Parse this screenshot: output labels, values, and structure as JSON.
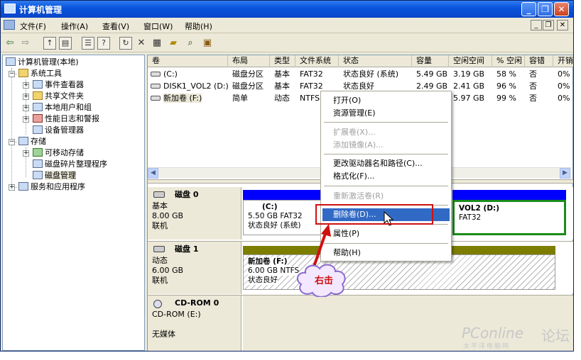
{
  "window": {
    "title": "计算机管理"
  },
  "menu": {
    "items": [
      "文件(F)",
      "操作(A)",
      "查看(V)",
      "窗口(W)",
      "帮助(H)"
    ]
  },
  "toolbar": {
    "icons": [
      "back-icon",
      "forward-icon",
      "up-folder-icon",
      "show-tree-icon",
      "properties-icon",
      "help-icon",
      "refresh-icon",
      "delete-icon",
      "properties2-icon",
      "open-icon",
      "search-icon",
      "help-book-icon"
    ]
  },
  "tree": {
    "root": "计算机管理(本地)",
    "system_tools": "系统工具",
    "event_viewer": "事件查看器",
    "shared_folders": "共享文件夹",
    "local_users": "本地用户和组",
    "perf_logs": "性能日志和警报",
    "device_manager": "设备管理器",
    "storage": "存储",
    "removable": "可移动存储",
    "defrag": "磁盘碎片整理程序",
    "disk_mgmt": "磁盘管理",
    "services": "服务和应用程序"
  },
  "volumes": {
    "columns": [
      "卷",
      "布局",
      "类型",
      "文件系统",
      "状态",
      "容量",
      "空闲空间",
      "% 空闲",
      "容错",
      "开销"
    ],
    "rows": [
      [
        "(C:)",
        "磁盘分区",
        "基本",
        "FAT32",
        "状态良好 (系统)",
        "5.49 GB",
        "3.19 GB",
        "58 %",
        "否",
        "0%"
      ],
      [
        "DISK1_VOL2 (D:)",
        "磁盘分区",
        "基本",
        "FAT32",
        "状态良好",
        "2.49 GB",
        "2.41 GB",
        "96 %",
        "否",
        "0%"
      ],
      [
        "新加卷 (F:)",
        "简单",
        "动态",
        "NTFS",
        "",
        "",
        "5.97 GB",
        "99 %",
        "否",
        "0%"
      ]
    ]
  },
  "disks": {
    "disk0": {
      "name": "磁盘 0",
      "type": "基本",
      "size": "8.00 GB",
      "status": "联机",
      "part1_name": "(C:)",
      "part1_size": "5.50 GB FAT32",
      "part1_status": "状态良好 (系统)",
      "part2_name": "VOL2  (D:)",
      "part2_fs": "FAT32"
    },
    "disk1": {
      "name": "磁盘 1",
      "type": "动态",
      "size": "6.00 GB",
      "status": "联机",
      "part_name": "新加卷  (F:)",
      "part_size": "6.00 GB NTFS",
      "part_status": "状态良好"
    },
    "cdrom": {
      "name": "CD-ROM 0",
      "drive": "CD-ROM (E:)",
      "status": "无媒体"
    }
  },
  "context_menu": {
    "open": "打开(O)",
    "explore": "资源管理(E)",
    "extend": "扩展卷(X)...",
    "add_mirror": "添加镜像(A)...",
    "change_letter": "更改驱动器名和路径(C)...",
    "format": "格式化(F)...",
    "reactivate": "重新激活卷(R)",
    "delete": "删除卷(D)...",
    "properties": "属性(P)",
    "help": "帮助(H)"
  },
  "annotation": {
    "callout": "右击"
  },
  "watermark": {
    "brand": "PConline",
    "forum": "论坛",
    "tagline": "太平洋电脑网"
  },
  "colors": {
    "titlebar": "#0a55dd",
    "selection": "#316ac5",
    "primary_partition": "#0000ff",
    "dynamic_volume": "#7d7d00",
    "highlight_red": "#d01010"
  }
}
